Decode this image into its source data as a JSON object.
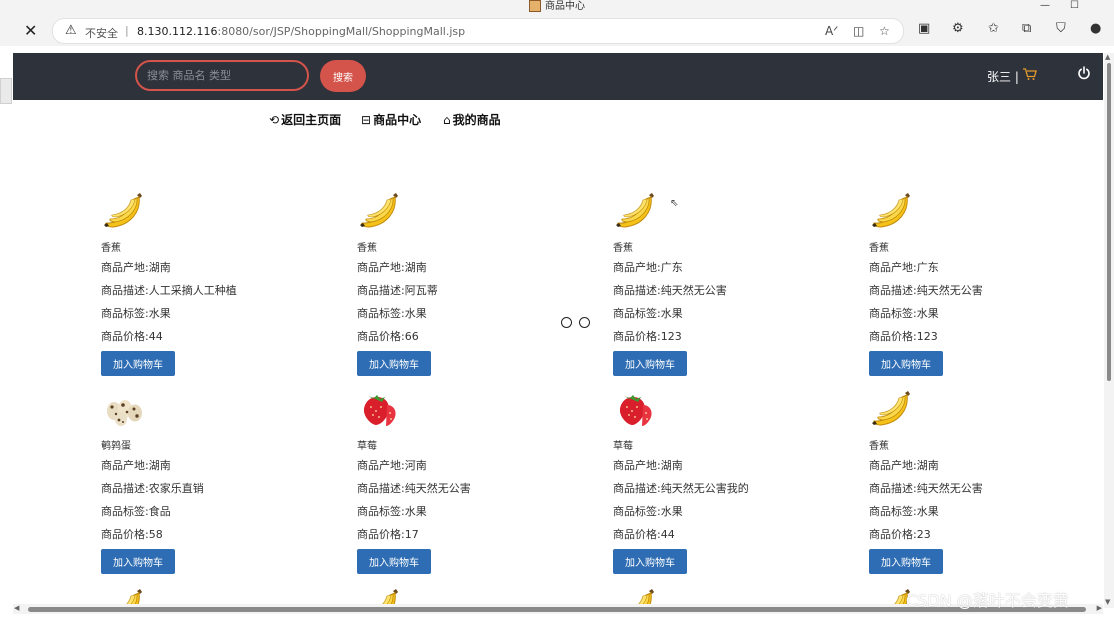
{
  "window": {
    "tab_title": "商品中心"
  },
  "browser": {
    "security_label": "不安全",
    "url_host": "8.130.112.116",
    "url_port_path": ":8080/sor/JSP/ShoppingMall/ShoppingMall.jsp"
  },
  "header": {
    "search_placeholder": "搜索 商品名 类型",
    "search_button": "搜索",
    "user_name": "张三",
    "divider": "|"
  },
  "subnav": {
    "home": "返回主页面",
    "center": "商品中心",
    "mine": "我的商品"
  },
  "labels": {
    "origin": "商品产地:",
    "desc": "商品描述:",
    "tag": "商品标签:",
    "price": "商品价格:",
    "add_cart": "加入购物车"
  },
  "products": [
    {
      "name": "香蕉",
      "icon": "banana",
      "origin": "湖南",
      "desc": "人工采摘人工种植",
      "tag": "水果",
      "price": "44"
    },
    {
      "name": "香蕉",
      "icon": "banana",
      "origin": "湖南",
      "desc": "阿瓦蒂",
      "tag": "水果",
      "price": "66"
    },
    {
      "name": "香蕉",
      "icon": "banana",
      "origin": "广东",
      "desc": "纯天然无公害",
      "tag": "水果",
      "price": "123"
    },
    {
      "name": "香蕉",
      "icon": "banana",
      "origin": "广东",
      "desc": "纯天然无公害",
      "tag": "水果",
      "price": "123"
    },
    {
      "name": "鹌鹑蛋",
      "icon": "quail-eggs",
      "origin": "湖南",
      "desc": "农家乐直销",
      "tag": "食品",
      "price": "58"
    },
    {
      "name": "草莓",
      "icon": "strawberry",
      "origin": "河南",
      "desc": "纯天然无公害",
      "tag": "水果",
      "price": "17"
    },
    {
      "name": "草莓",
      "icon": "strawberry",
      "origin": "湖南",
      "desc": "纯天然无公害我的",
      "tag": "水果",
      "price": "44"
    },
    {
      "name": "香蕉",
      "icon": "banana",
      "origin": "湖南",
      "desc": "纯天然无公害",
      "tag": "水果",
      "price": "23"
    }
  ],
  "watermark": "CSDN @落叶不会变黄"
}
